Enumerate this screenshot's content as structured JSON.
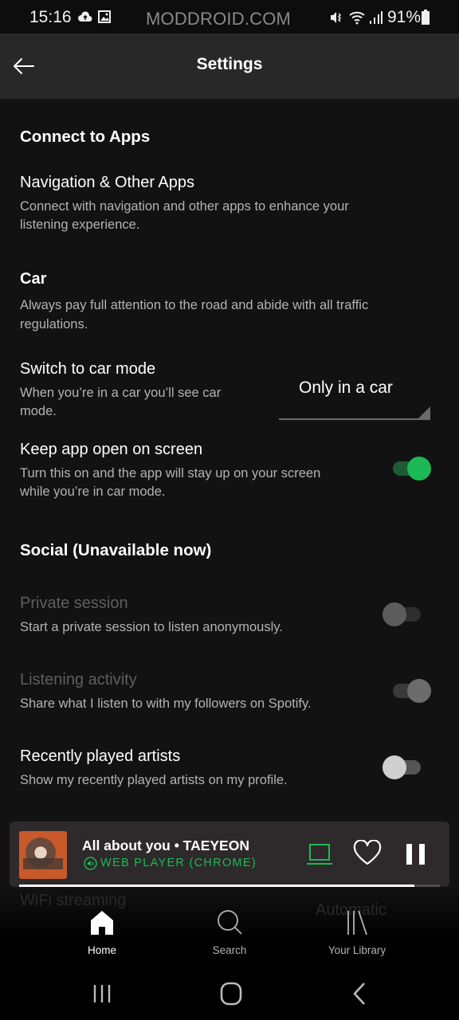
{
  "status_bar": {
    "time": "15:16",
    "watermark": "MODDROID.COM",
    "battery": "91%",
    "icons": [
      "cloud-upload-icon",
      "image-icon",
      "mute-vibrate-icon",
      "wifi-icon",
      "signal-icon",
      "battery-icon"
    ]
  },
  "header": {
    "title": "Settings",
    "back_icon": "arrow-left-icon"
  },
  "sections": {
    "connect": {
      "title": "Connect to Apps",
      "items": [
        {
          "title": "Navigation & Other Apps",
          "description_lines": [
            "Connect with navigation and other apps to enhance your",
            "listening experience."
          ]
        }
      ]
    },
    "car": {
      "title": "Car",
      "description_lines": [
        "Always pay full attention to the road and abide with all traffic",
        "regulations."
      ],
      "switch_car_mode": {
        "title": "Switch to car mode",
        "description_lines": [
          "When you’re in a car you’ll see car",
          "mode."
        ],
        "selected_option": "Only in a car"
      },
      "keep_app_open": {
        "title": "Keep app open on screen",
        "description_lines": [
          "Turn this on and the app will stay up on your screen",
          "while you’re in car mode."
        ],
        "enabled": true
      }
    },
    "social": {
      "title": "Social (Unavailable now)",
      "private_session": {
        "title": "Private session",
        "description": "Start a private session to listen anonymously.",
        "enabled": false,
        "disabled": true
      },
      "listening_activity": {
        "title": "Listening activity",
        "description": "Share what I listen to with my followers on Spotify.",
        "enabled": true,
        "disabled": true
      },
      "recently_played": {
        "title": "Recently played artists",
        "description": "Show my recently played artists on my profile.",
        "enabled": false
      }
    },
    "hidden_behind_nav": {
      "wifi_streaming": "WiFi streaming",
      "wifi_value": "Automatic"
    }
  },
  "now_playing": {
    "title": "All about you • TAEYEON",
    "device": "WEB PLAYER (CHROME)",
    "progress_fraction": 0.94,
    "liked": false,
    "playing": true
  },
  "bottom_nav": {
    "items": [
      {
        "label": "Home",
        "icon": "home-icon",
        "active": true
      },
      {
        "label": "Search",
        "icon": "search-icon",
        "active": false
      },
      {
        "label": "Your Library",
        "icon": "library-icon",
        "active": false
      }
    ]
  },
  "colors": {
    "accent": "#1db954",
    "background": "#121212",
    "header": "#282828"
  }
}
